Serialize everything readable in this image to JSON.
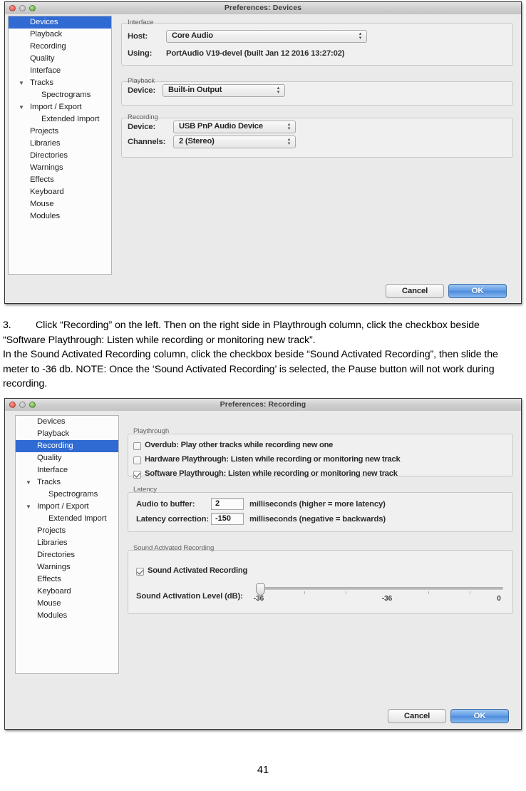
{
  "page": {
    "number": "41"
  },
  "figure_devices": {
    "window_title": "Preferences: Devices",
    "traffic_lights": [
      "close",
      "minimize",
      "zoom"
    ],
    "sidebar": [
      {
        "label": "Devices",
        "level": 0,
        "selected": true,
        "triangle": ""
      },
      {
        "label": "Playback",
        "level": 0,
        "selected": false,
        "triangle": ""
      },
      {
        "label": "Recording",
        "level": 0,
        "selected": false,
        "triangle": ""
      },
      {
        "label": "Quality",
        "level": 0,
        "selected": false,
        "triangle": ""
      },
      {
        "label": "Interface",
        "level": 0,
        "selected": false,
        "triangle": ""
      },
      {
        "label": "Tracks",
        "level": 0,
        "selected": false,
        "triangle": "▼"
      },
      {
        "label": "Spectrograms",
        "level": 1,
        "selected": false,
        "triangle": ""
      },
      {
        "label": "Import / Export",
        "level": 0,
        "selected": false,
        "triangle": "▼"
      },
      {
        "label": "Extended Import",
        "level": 1,
        "selected": false,
        "triangle": ""
      },
      {
        "label": "Projects",
        "level": 0,
        "selected": false,
        "triangle": ""
      },
      {
        "label": "Libraries",
        "level": 0,
        "selected": false,
        "triangle": ""
      },
      {
        "label": "Directories",
        "level": 0,
        "selected": false,
        "triangle": ""
      },
      {
        "label": "Warnings",
        "level": 0,
        "selected": false,
        "triangle": ""
      },
      {
        "label": "Effects",
        "level": 0,
        "selected": false,
        "triangle": ""
      },
      {
        "label": "Keyboard",
        "level": 0,
        "selected": false,
        "triangle": ""
      },
      {
        "label": "Mouse",
        "level": 0,
        "selected": false,
        "triangle": ""
      },
      {
        "label": "Modules",
        "level": 0,
        "selected": false,
        "triangle": ""
      }
    ],
    "interface_group": {
      "title": "Interface",
      "host_label": "Host:",
      "host_value": "Core Audio",
      "using_label": "Using:",
      "using_value": "PortAudio V19-devel (built Jan 12 2016 13:27:02)"
    },
    "playback_group": {
      "title": "Playback",
      "device_label": "Device:",
      "device_value": "Built-in Output"
    },
    "recording_group": {
      "title": "Recording",
      "device_label": "Device:",
      "device_value": "USB PnP Audio Device",
      "channels_label": "Channels:",
      "channels_value": "2 (Stereo)"
    },
    "buttons": {
      "cancel": "Cancel",
      "ok": "OK"
    }
  },
  "instructions": {
    "step_number": "3.",
    "paragraph1": "Click “Recording” on the left. Then on the right side in Playthrough column, click the checkbox beside “Software Playthrough: Listen while recording or monitoring new track”.",
    "paragraph2": "In the Sound Activated Recording column, click the checkbox beside “Sound Activated Recording”, then slide the meter to -36 db. NOTE: Once the ‘Sound Activated Recording’ is selected, the Pause button will not work during recording."
  },
  "figure_recording": {
    "window_title": "Preferences: Recording",
    "traffic_lights": [
      "close",
      "minimize",
      "zoom"
    ],
    "sidebar": [
      {
        "label": "Devices",
        "level": 0,
        "selected": false,
        "triangle": ""
      },
      {
        "label": "Playback",
        "level": 0,
        "selected": false,
        "triangle": ""
      },
      {
        "label": "Recording",
        "level": 0,
        "selected": true,
        "triangle": ""
      },
      {
        "label": "Quality",
        "level": 0,
        "selected": false,
        "triangle": ""
      },
      {
        "label": "Interface",
        "level": 0,
        "selected": false,
        "triangle": ""
      },
      {
        "label": "Tracks",
        "level": 0,
        "selected": false,
        "triangle": "▼"
      },
      {
        "label": "Spectrograms",
        "level": 1,
        "selected": false,
        "triangle": ""
      },
      {
        "label": "Import / Export",
        "level": 0,
        "selected": false,
        "triangle": "▼"
      },
      {
        "label": "Extended Import",
        "level": 1,
        "selected": false,
        "triangle": ""
      },
      {
        "label": "Projects",
        "level": 0,
        "selected": false,
        "triangle": ""
      },
      {
        "label": "Libraries",
        "level": 0,
        "selected": false,
        "triangle": ""
      },
      {
        "label": "Directories",
        "level": 0,
        "selected": false,
        "triangle": ""
      },
      {
        "label": "Warnings",
        "level": 0,
        "selected": false,
        "triangle": ""
      },
      {
        "label": "Effects",
        "level": 0,
        "selected": false,
        "triangle": ""
      },
      {
        "label": "Keyboard",
        "level": 0,
        "selected": false,
        "triangle": ""
      },
      {
        "label": "Mouse",
        "level": 0,
        "selected": false,
        "triangle": ""
      },
      {
        "label": "Modules",
        "level": 0,
        "selected": false,
        "triangle": ""
      }
    ],
    "playthrough_group": {
      "title": "Playthrough",
      "checkboxes": [
        {
          "label": "Overdub: Play other tracks while recording new one",
          "checked": false
        },
        {
          "label": "Hardware Playthrough: Listen while recording or monitoring new track",
          "checked": false
        },
        {
          "label": "Software Playthrough: Listen while recording or monitoring new track",
          "checked": true
        }
      ]
    },
    "latency_group": {
      "title": "Latency",
      "buffer_label": "Audio to buffer:",
      "buffer_value": "2",
      "buffer_suffix": "milliseconds (higher = more latency)",
      "correction_label": "Latency correction:",
      "correction_value": "-150",
      "correction_suffix": "milliseconds (negative = backwards)"
    },
    "sar_group": {
      "title": "Sound Activated Recording",
      "enable_label": "Sound Activated Recording",
      "enable_checked": true,
      "level_label": "Sound Activation Level (dB):",
      "slider_value": "-36",
      "tick_labels": [
        "-36",
        "-36",
        "0"
      ]
    },
    "buttons": {
      "cancel": "Cancel",
      "ok": "OK"
    }
  }
}
